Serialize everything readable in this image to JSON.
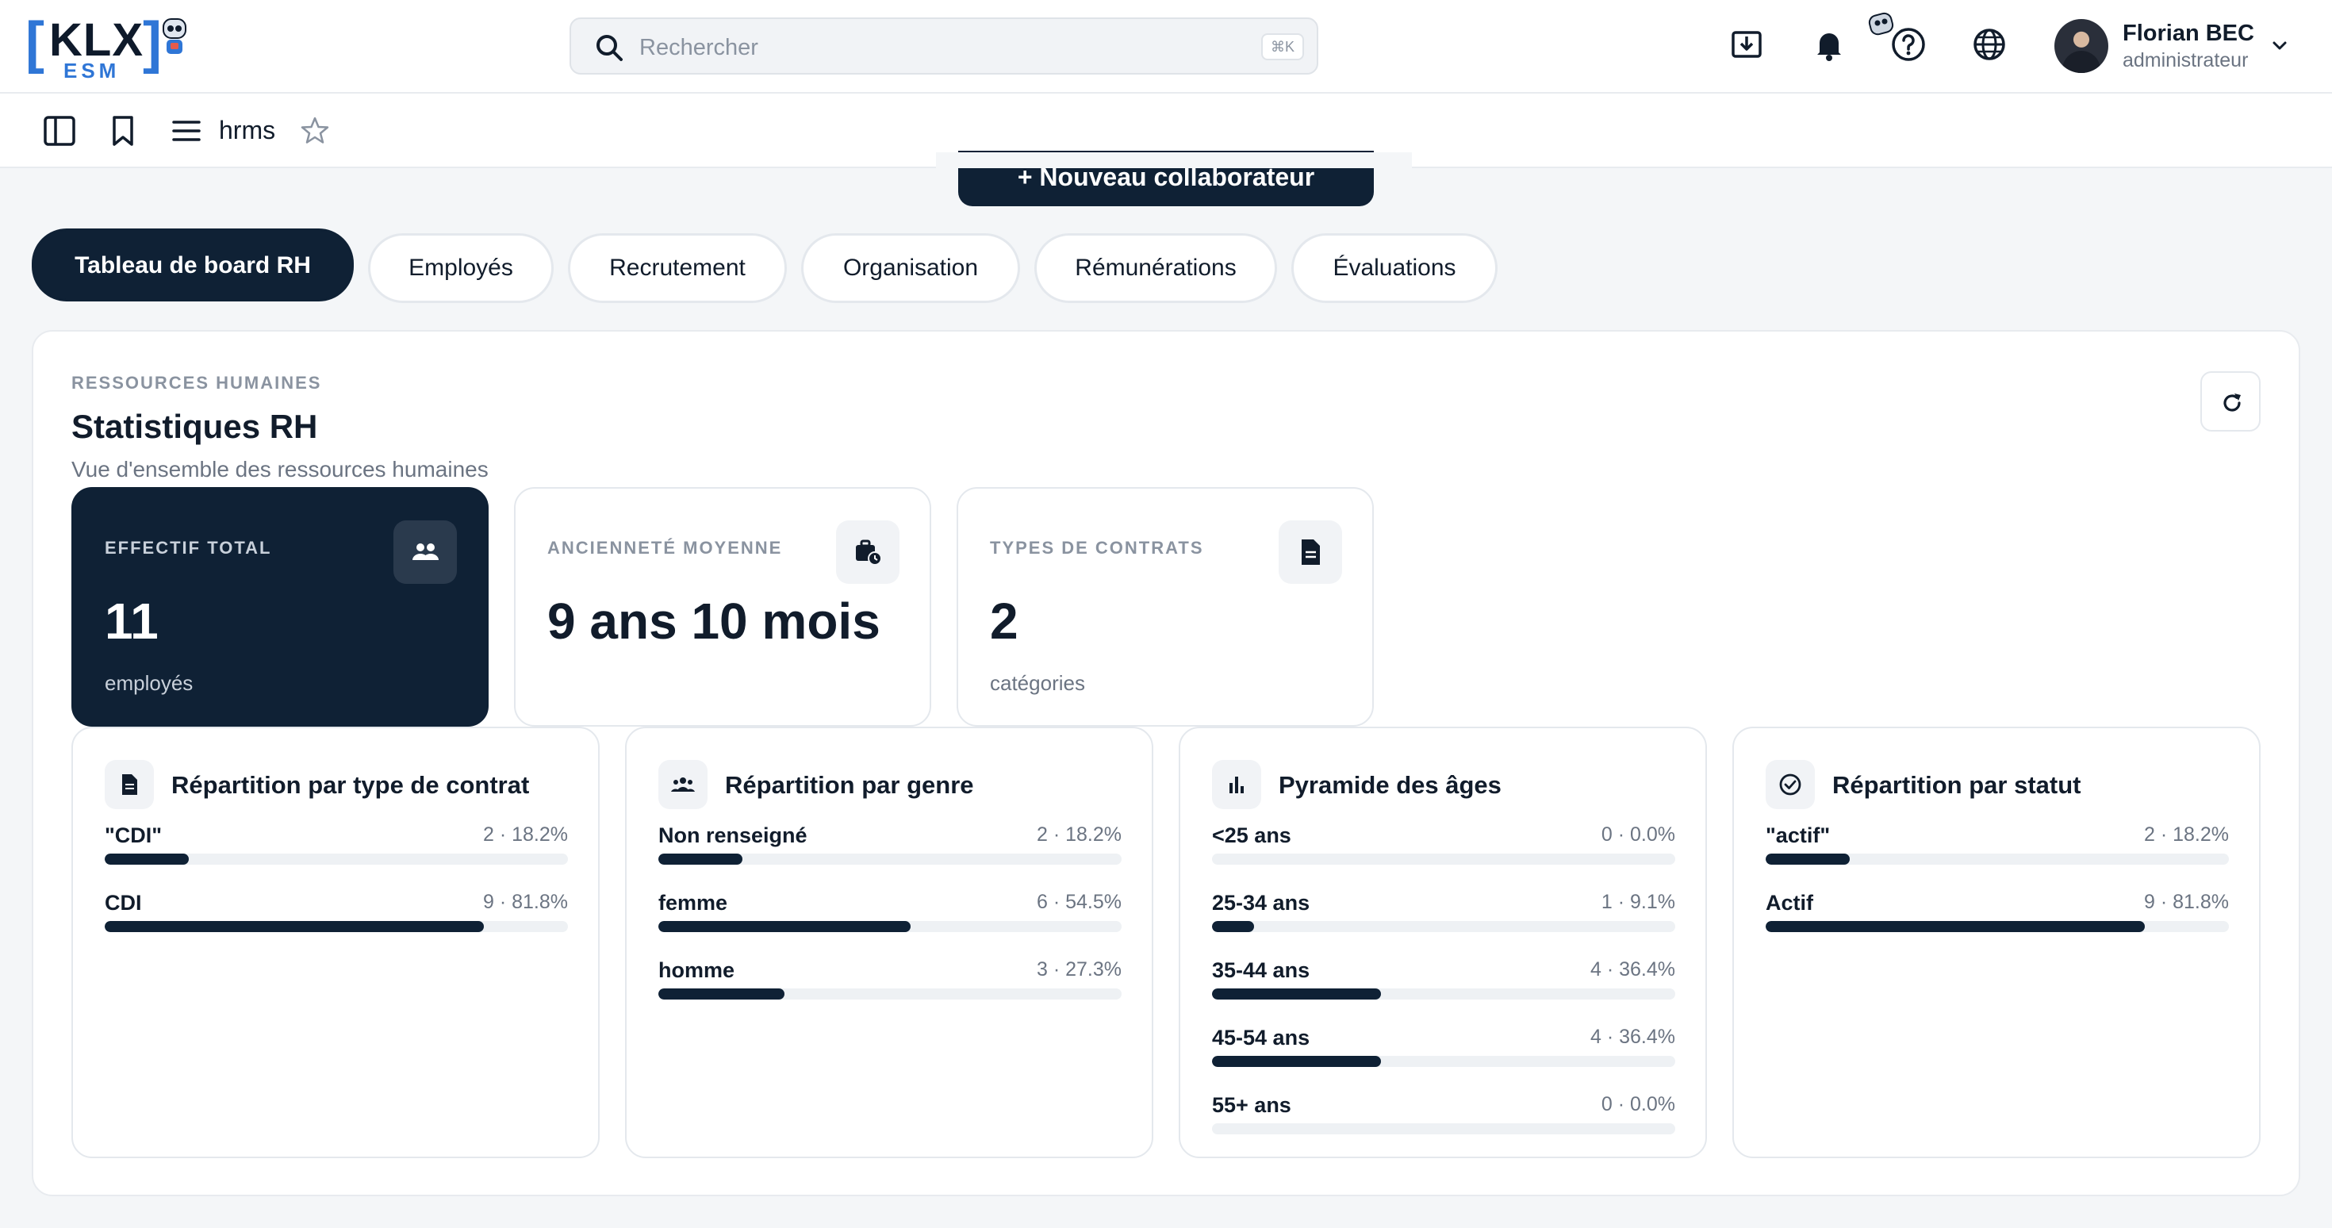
{
  "header": {
    "logo": {
      "left_bracket": "[",
      "name": "KLX",
      "right_bracket": "]",
      "sub": "ESM"
    },
    "search": {
      "placeholder": "Rechercher",
      "shortcut": "⌘K"
    },
    "icons": [
      "download-icon",
      "bell-icon",
      "help-icon",
      "globe-icon"
    ],
    "user": {
      "name": "Florian BEC",
      "role": "administrateur"
    }
  },
  "toolbar": {
    "breadcrumb": "hrms"
  },
  "new_button": {
    "label": "+  Nouveau collaborateur"
  },
  "tabs": [
    {
      "label": "Tableau de board RH",
      "active": true
    },
    {
      "label": "Employés",
      "active": false
    },
    {
      "label": "Recrutement",
      "active": false
    },
    {
      "label": "Organisation",
      "active": false
    },
    {
      "label": "Rémunérations",
      "active": false
    },
    {
      "label": "Évaluations",
      "active": false
    }
  ],
  "panel": {
    "eyebrow": "RESSOURCES HUMAINES",
    "title": "Statistiques RH",
    "subtitle": "Vue d'ensemble des ressources humaines"
  },
  "stats": [
    {
      "label": "EFFECTIF TOTAL",
      "value": "11",
      "unit": "employés",
      "icon": "users-icon"
    },
    {
      "label": "ANCIENNETÉ MOYENNE",
      "value": "9 ans 10 mois",
      "unit": "",
      "icon": "briefcase-clock-icon"
    },
    {
      "label": "TYPES DE CONTRATS",
      "value": "2",
      "unit": "catégories",
      "icon": "document-icon"
    }
  ],
  "distributions": [
    {
      "title": "Répartition par type de contrat",
      "icon": "document-icon",
      "rows": [
        {
          "label": "\"CDI\"",
          "value": "2 · 18.2%",
          "pct": 18.2
        },
        {
          "label": "CDI",
          "value": "9 · 81.8%",
          "pct": 81.8
        }
      ]
    },
    {
      "title": "Répartition par genre",
      "icon": "group-icon",
      "rows": [
        {
          "label": "Non renseigné",
          "value": "2 · 18.2%",
          "pct": 18.2
        },
        {
          "label": "femme",
          "value": "6 · 54.5%",
          "pct": 54.5
        },
        {
          "label": "homme",
          "value": "3 · 27.3%",
          "pct": 27.3
        }
      ]
    },
    {
      "title": "Pyramide des âges",
      "icon": "bar-chart-icon",
      "rows": [
        {
          "label": "<25 ans",
          "value": "0 · 0.0%",
          "pct": 0
        },
        {
          "label": "25-34 ans",
          "value": "1 · 9.1%",
          "pct": 9.1
        },
        {
          "label": "35-44 ans",
          "value": "4 · 36.4%",
          "pct": 36.4
        },
        {
          "label": "45-54 ans",
          "value": "4 · 36.4%",
          "pct": 36.4
        },
        {
          "label": "55+ ans",
          "value": "0 · 0.0%",
          "pct": 0
        }
      ]
    },
    {
      "title": "Répartition par statut",
      "icon": "check-circle-icon",
      "rows": [
        {
          "label": "\"actif\"",
          "value": "2 · 18.2%",
          "pct": 18.2
        },
        {
          "label": "Actif",
          "value": "9 · 81.8%",
          "pct": 81.8
        }
      ]
    }
  ]
}
